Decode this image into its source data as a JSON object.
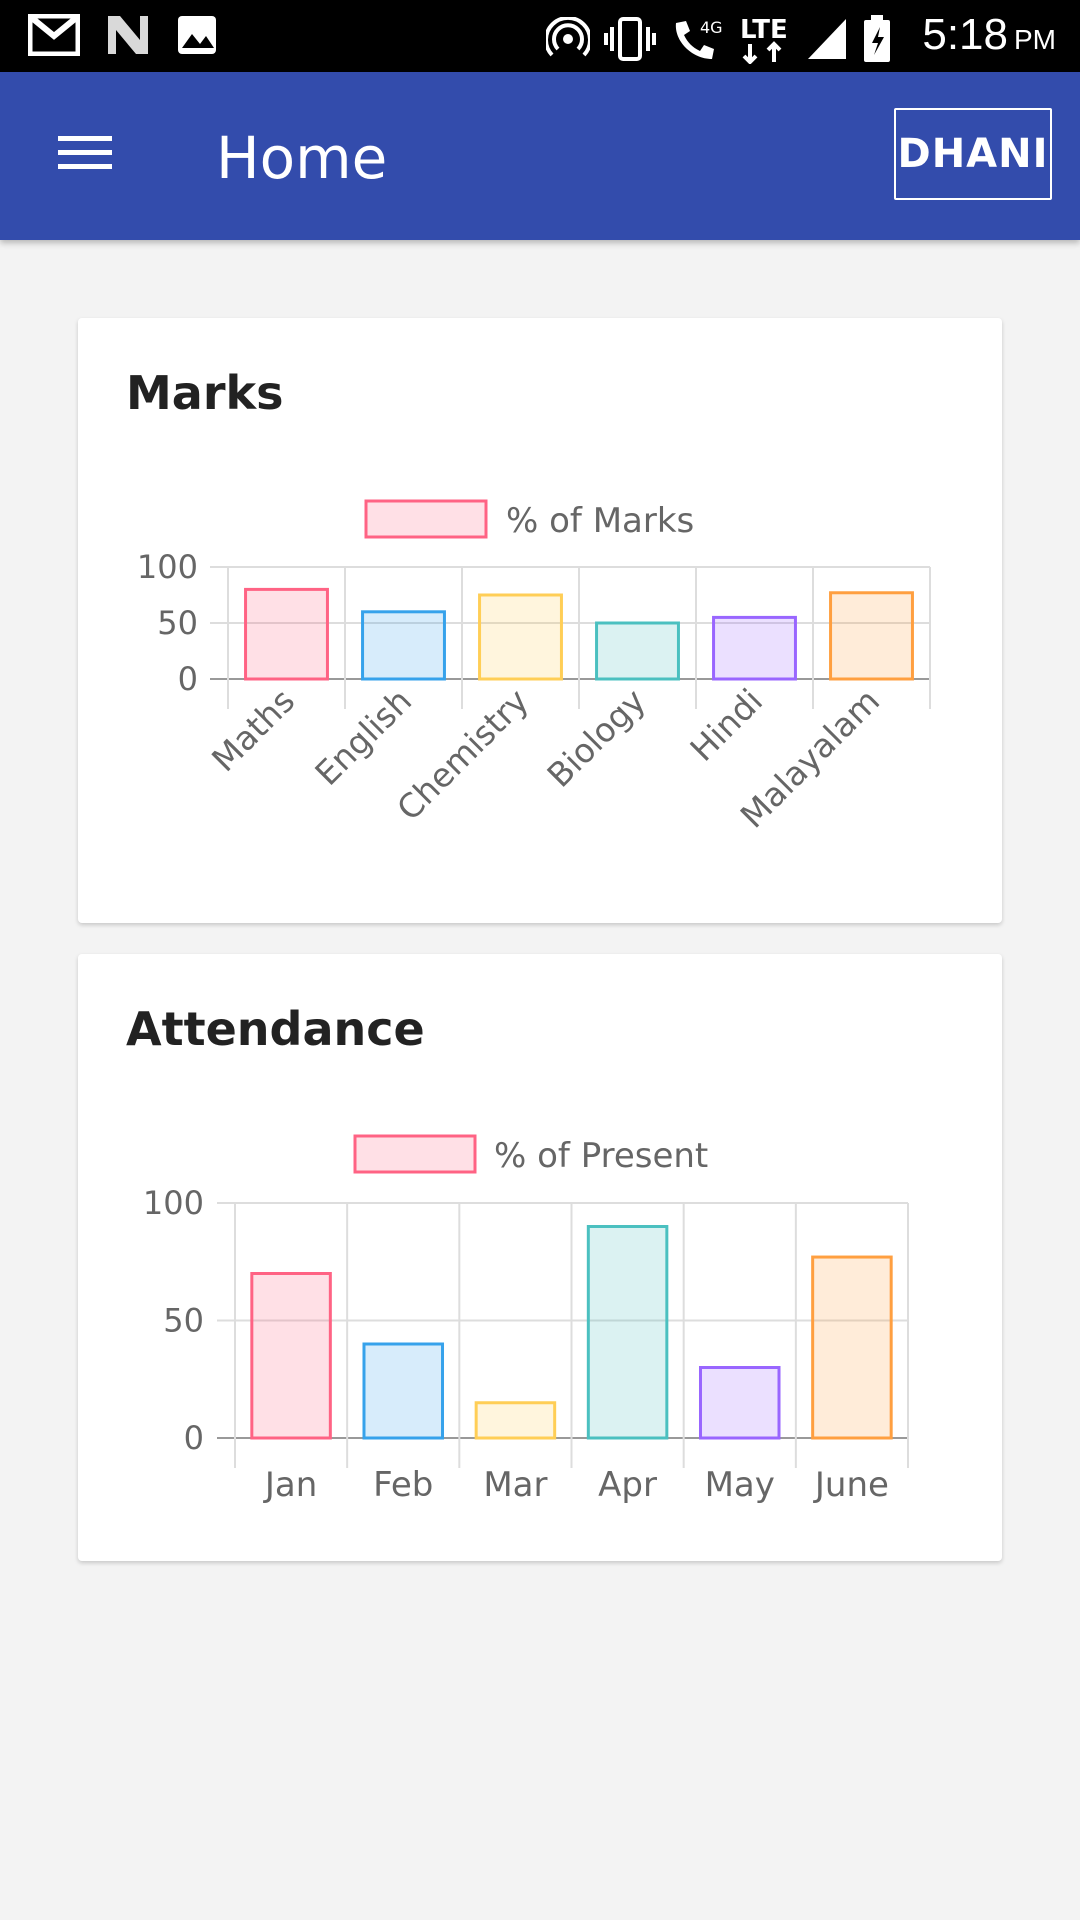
{
  "status_bar": {
    "time": "5:18",
    "ampm": "PM",
    "icons": [
      "gmail-icon",
      "n-icon",
      "gallery-icon",
      "hotspot-icon",
      "vibrate-icon",
      "wifi-call-icon",
      "lte-icon",
      "signal-icon",
      "battery-icon"
    ],
    "network_label": "4G",
    "lte_label": "LTE"
  },
  "app_bar": {
    "title": "Home",
    "user_button": "DHANI",
    "background": "#334cac"
  },
  "chart_data": [
    {
      "type": "bar",
      "card_title": "Marks",
      "legend": "% of Marks",
      "categories": [
        "Maths",
        "English",
        "Chemistry",
        "Biology",
        "Hindi",
        "Malayalam"
      ],
      "values": [
        80,
        60,
        75,
        50,
        55,
        77
      ],
      "ylim": [
        0,
        100
      ],
      "yticks": [
        "100",
        "50",
        "0"
      ],
      "grid": true,
      "legend_position": "top",
      "x_labels_rotated": true,
      "colors": [
        "#ff6384",
        "#36a2eb",
        "#ffce56",
        "#4bc0c0",
        "#9966ff",
        "#ff9f40"
      ]
    },
    {
      "type": "bar",
      "card_title": "Attendance",
      "legend": "% of Present",
      "categories": [
        "Jan",
        "Feb",
        "Mar",
        "Apr",
        "May",
        "June"
      ],
      "values": [
        70,
        40,
        15,
        90,
        30,
        77
      ],
      "ylim": [
        0,
        100
      ],
      "yticks": [
        "100",
        "50",
        "0"
      ],
      "grid": true,
      "legend_position": "top",
      "x_labels_rotated": false,
      "colors": [
        "#ff6384",
        "#36a2eb",
        "#ffce56",
        "#4bc0c0",
        "#9966ff",
        "#ff9f40"
      ]
    }
  ]
}
